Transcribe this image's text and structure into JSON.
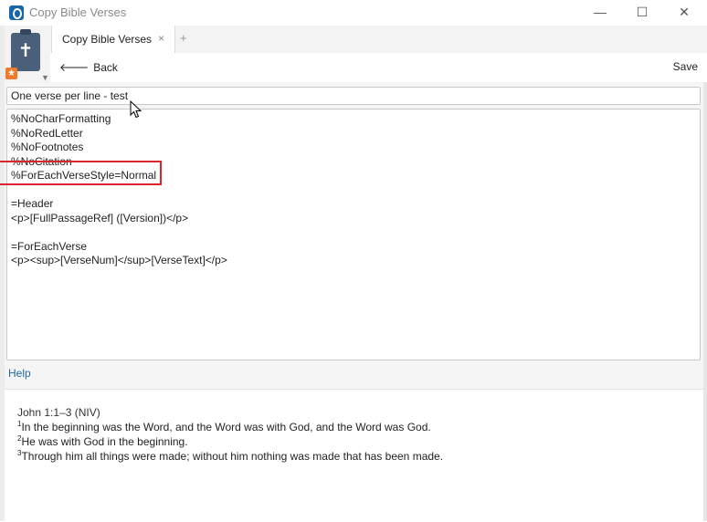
{
  "window": {
    "title": "Copy Bible Verses",
    "minimize_glyph": "—",
    "maximize_glyph": "☐",
    "close_glyph": "✕"
  },
  "panel_icon": {
    "name": "clipboard-cross-icon",
    "badge": "star-icon",
    "badge_glyph": "★",
    "cross_glyph": "✝",
    "menu_glyph": "▼"
  },
  "tabs": [
    {
      "label": "Copy Bible Verses",
      "close_glyph": "×"
    }
  ],
  "add_tab_glyph": "+",
  "toolbar": {
    "back_arrow": "🡐",
    "back_label": "Back",
    "save_label": "Save"
  },
  "style_name": "One verse per line - test",
  "editor_lines": [
    "%NoCharFormatting",
    "%NoRedLetter",
    "%NoFootnotes",
    "%NoCitation",
    "%ForEachVerseStyle=Normal",
    "",
    "=Header",
    "<p>[FullPassageRef] ([Version])</p>",
    "",
    "=ForEachVerse",
    "<p><sup>[VerseNum]</sup>[VerseText]</p>"
  ],
  "help_label": "Help",
  "preview": {
    "reference": "John 1:1–3 (NIV)",
    "verses": [
      {
        "num": "1",
        "text": "In the beginning was the Word, and the Word was with God, and the Word was God."
      },
      {
        "num": "2",
        "text": "He was with God in the beginning."
      },
      {
        "num": "3",
        "text": "Through him all things were made; without him nothing was made that has been made."
      }
    ]
  },
  "colors": {
    "accent": "#1565a8",
    "highlight_box": "#d9262c",
    "help_link": "#1f6aa5",
    "badge": "#ef7b2a",
    "panel_icon": "#4a5f7a"
  }
}
